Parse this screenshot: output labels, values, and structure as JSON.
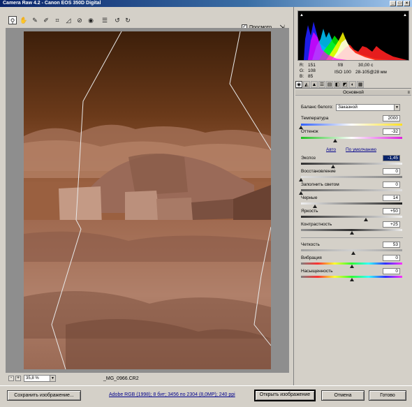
{
  "window": {
    "title": "Camera Raw 4.2  -  Canon EOS 350D Digital",
    "min": "_",
    "max": "□",
    "close": "×"
  },
  "toolbar": {
    "tools": [
      {
        "name": "zoom-tool-icon",
        "glyph": "⚲"
      },
      {
        "name": "hand-tool-icon",
        "glyph": "✋"
      },
      {
        "name": "white-balance-tool-icon",
        "glyph": "✎"
      },
      {
        "name": "color-sampler-tool-icon",
        "glyph": "✐"
      },
      {
        "name": "crop-tool-icon",
        "glyph": "⌗"
      },
      {
        "name": "straighten-tool-icon",
        "glyph": "◿"
      },
      {
        "name": "retouch-tool-icon",
        "glyph": "⊘"
      },
      {
        "name": "red-eye-tool-icon",
        "glyph": "◉"
      },
      {
        "name": "preferences-icon",
        "glyph": "☰"
      },
      {
        "name": "rotate-left-icon",
        "glyph": "↺"
      },
      {
        "name": "rotate-right-icon",
        "glyph": "↻"
      }
    ],
    "preview_label": "Просмотр",
    "preview_check": "✓",
    "fullscreen_glyph": "⇲"
  },
  "status": {
    "zoom_minus": "-",
    "zoom_plus": "+",
    "zoom_value": "35,8 %",
    "zoom_arrow": "▼",
    "filename": "_MG_0966.CR2"
  },
  "info": {
    "r_label": "R:",
    "r_value": "151",
    "g_label": "G:",
    "g_value": "108",
    "b_label": "B:",
    "b_value": "85",
    "aperture": "f/8",
    "shutter": "30,00 с",
    "iso": "ISO 100",
    "lens": "28-105@28 мм"
  },
  "panel": {
    "tabs": [
      "◉",
      "◭",
      "▲",
      "☰",
      "▤",
      "◧",
      "◩",
      "◐",
      "▦"
    ],
    "title": "Основной",
    "menu": "≡",
    "wb_label": "Баланс белого:",
    "wb_value": "Заказной",
    "wb_arrow": "▼",
    "auto_link": "Авто",
    "default_link": "По умолчанию"
  },
  "sliders": {
    "temperature": {
      "label": "Температура",
      "value": "2000",
      "position": 0.0
    },
    "tint": {
      "label": "Оттенок",
      "value": "-32",
      "position": 0.34
    },
    "exposure": {
      "label": "Экспоз",
      "value": "-1,45",
      "position": 0.32
    },
    "recovery": {
      "label": "Восстановление",
      "value": "0",
      "position": 0.0
    },
    "fill": {
      "label": "Заполнить светом",
      "value": "0",
      "position": 0.0
    },
    "blacks": {
      "label": "Черные",
      "value": "14",
      "position": 0.14
    },
    "brightness": {
      "label": "Яркость",
      "value": "+50",
      "position": 0.64
    },
    "contrast": {
      "label": "Контрастность",
      "value": "+25",
      "position": 0.5
    },
    "clarity": {
      "label": "Четкость",
      "value": "53",
      "position": 0.52
    },
    "vibrance": {
      "label": "Вибрация",
      "value": "0",
      "position": 0.5
    },
    "saturation": {
      "label": "Насыщенность",
      "value": "0",
      "position": 0.5
    }
  },
  "bottom": {
    "save_button": "Сохранить изображение...",
    "workflow_link": "Adobe RGB (1998); 8 бит; 3456 по 2304 (8,0MP); 240 ppi",
    "open_button": "Открыть изображение",
    "cancel_button": "Отмена",
    "done_button": "Готово"
  },
  "colors": {
    "accent": "#0a246a",
    "panel": "#d4d0c8",
    "canvas": "#8e8e8e"
  }
}
